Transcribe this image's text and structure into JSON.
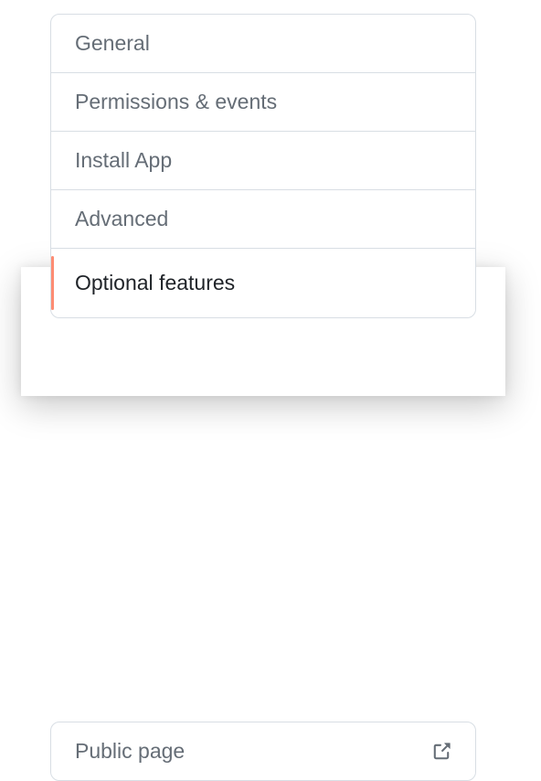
{
  "nav": {
    "items": [
      {
        "label": "General",
        "selected": false
      },
      {
        "label": "Permissions & events",
        "selected": false
      },
      {
        "label": "Install App",
        "selected": false
      },
      {
        "label": "Advanced",
        "selected": false
      },
      {
        "label": "Optional features",
        "selected": true
      }
    ]
  },
  "nav2": {
    "items": [
      {
        "label": "Public page",
        "external": true
      }
    ]
  }
}
